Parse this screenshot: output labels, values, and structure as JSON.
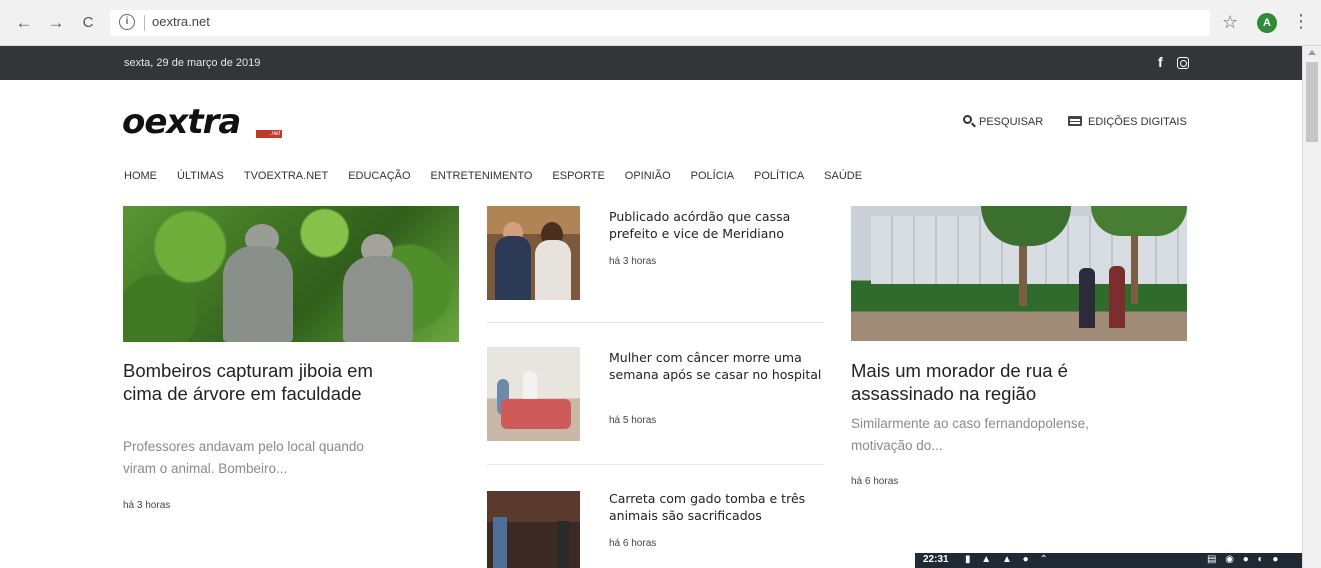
{
  "browser": {
    "url": "oextra.net",
    "back_glyph": "←",
    "forward_glyph": "→",
    "reload_glyph": "C",
    "info_glyph": "i",
    "star_glyph": "☆",
    "account_initial": "A",
    "menu_glyph": "⋮"
  },
  "topbar": {
    "date": "sexta, 29 de março de 2019",
    "facebook_glyph": "f"
  },
  "header": {
    "logo": "oextra",
    "logo_suffix": ".net",
    "search_label": "PESQUISAR",
    "editions_label": "EDIÇÕES DIGITAIS"
  },
  "nav": [
    "HOME",
    "ÚLTIMAS",
    "TVOEXTRA.NET",
    "EDUCAÇÃO",
    "ENTRETENIMENTO",
    "ESPORTE",
    "OPINIÃO",
    "POLÍCIA",
    "POLÍTICA",
    "SAÚDE"
  ],
  "featured_left": {
    "title": "Bombeiros capturam jiboia em cima de árvore em faculdade",
    "summary": "Professores andavam pelo local quando viram o animal. Bombeiro...",
    "time": "há 3 horas"
  },
  "middle_list": [
    {
      "title": "Publicado acórdão que cassa prefeito e vice de Meridiano",
      "time": "há 3 horas"
    },
    {
      "title": "Mulher com câncer morre uma semana após se casar no hospital",
      "time": "há 5 horas"
    },
    {
      "title": "Carreta com gado tomba e três animais são sacrificados",
      "time": "há 6 horas"
    }
  ],
  "featured_right": {
    "title": "Mais um morador de rua é assassinado na região",
    "summary": "Similarmente ao caso fernandopolense, motivação do...",
    "time": "há 6 horas"
  },
  "taskbar": {
    "time": "22:31",
    "icons": "▮ ▲ ▲ ●  ⌃",
    "right": "▤ ◉ ● ◐ ●"
  },
  "colors": {
    "topbar": "#333539",
    "logo_accent": "#c0392b",
    "account": "#2e8b3a"
  }
}
